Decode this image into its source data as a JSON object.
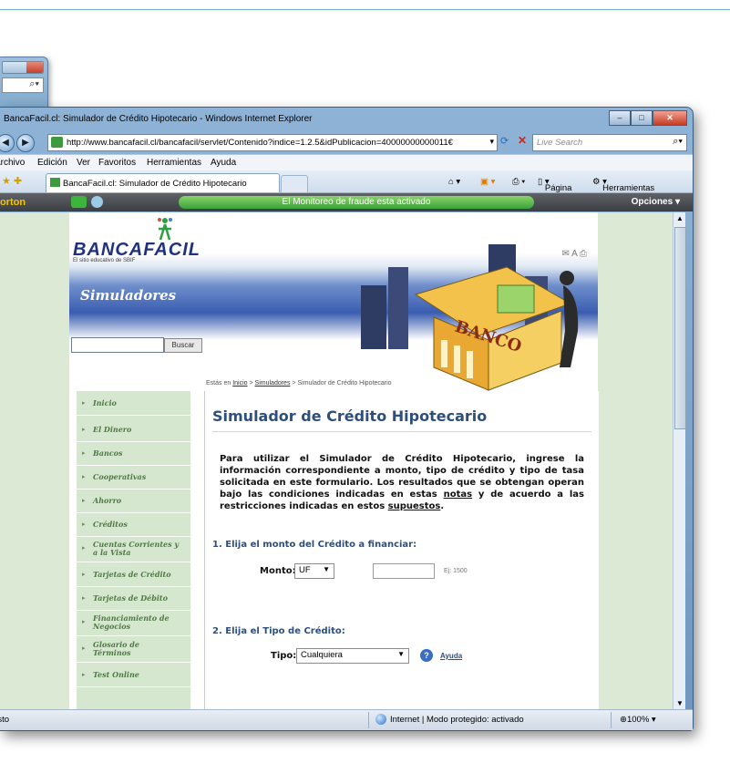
{
  "window": {
    "title": "BancaFacil.cl: Simulador de Crédito Hipotecario - Windows Internet Explorer",
    "url": "http://www.bancafacil.cl/bancafacil/servlet/Contenido?indice=1.2.5&idPublicacion=40000000000011€",
    "search_placeholder": "Live Search"
  },
  "menu": [
    "Archivo",
    "Edición",
    "Ver",
    "Favoritos",
    "Herramientas",
    "Ayuda"
  ],
  "tab": {
    "label": "BancaFacil.cl: Simulador de Crédito Hipotecario"
  },
  "toolbar": {
    "pagina": "Página",
    "herramientas": "Herramientas"
  },
  "norton": {
    "logo": "Norton",
    "fraud_text": "El Monitoreo de fraude esta activado",
    "opciones": "Opciones"
  },
  "site": {
    "logo": "BANCAFACIL",
    "logo_sub": "El sitio educativo de SBIF",
    "section_title": "Simuladores",
    "search_button": "Buscar",
    "banner_text": "BANCO",
    "breadcrumb": {
      "prefix": "Estás en",
      "home": "Inicio",
      "sep1": ">",
      "sim": "Simuladores",
      "sep2": ">",
      "current": "Simulador de Crédito Hipotecario"
    }
  },
  "nav": [
    "Inicio",
    "El Dinero",
    "Bancos",
    "Cooperativas",
    "Ahorro",
    "Créditos",
    "Cuentas Corrientes y a la Vista",
    "Tarjetas de Crédito",
    "Tarjetas de Débito",
    "Financiamiento de Negocios",
    "Glosario de Términos",
    "Test Online"
  ],
  "main": {
    "heading": "Simulador de Crédito Hipotecario",
    "intro_a": "Para utilizar el Simulador de Crédito Hipotecario, ingrese la información correspondiente a monto, tipo de crédito y tipo de tasa solicitada en este formulario. Los resultados que se obtengan operan bajo las condiciones indicadas en estas ",
    "intro_link1": "notas",
    "intro_b": " y de acuerdo a las restricciones indicadas en estos ",
    "intro_link2": "supuestos",
    "intro_c": ".",
    "step1": "1. Elija el monto del Crédito a financiar:",
    "monto_label": "Monto:",
    "monto_unit": "UF",
    "monto_hint": "Ej: 1500",
    "step2": "2. Elija el Tipo de Crédito:",
    "tipo_label": "Tipo:",
    "tipo_value": "Cualquiera",
    "ayuda": "Ayuda"
  },
  "status": {
    "left": "Listo",
    "zone": "Internet | Modo protegido: activado",
    "zoom": "100%"
  },
  "bgwindow": {
    "search_icon": "search-icon"
  }
}
